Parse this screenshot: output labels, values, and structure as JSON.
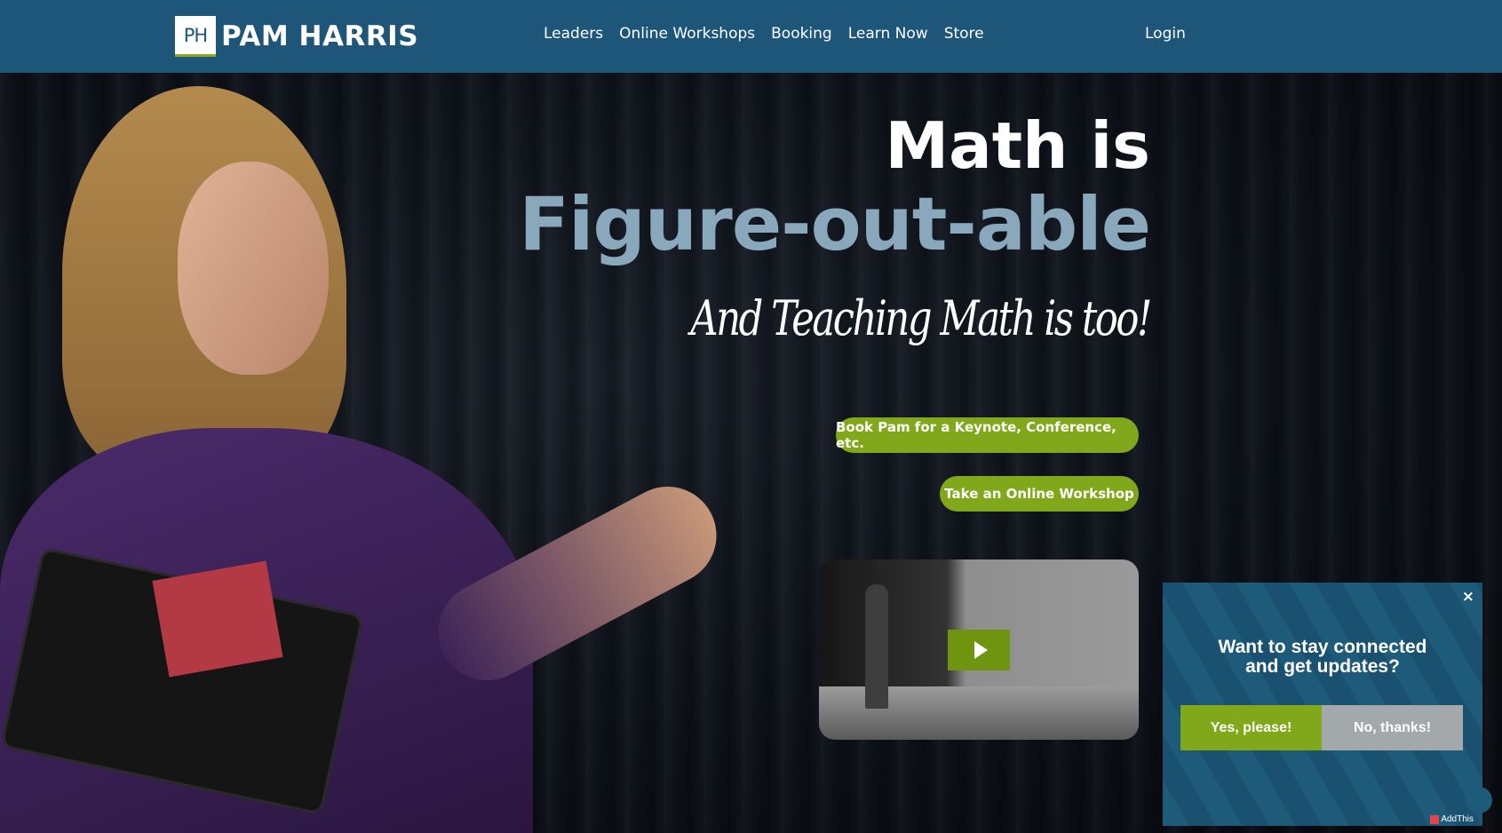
{
  "header": {
    "logo_mark": "PH",
    "logo_text": "PAM HARRIS",
    "nav": [
      "Leaders",
      "Online Workshops",
      "Booking",
      "Learn Now",
      "Store"
    ],
    "login": "Login"
  },
  "hero": {
    "headline_line1": "Math is",
    "headline_line2": "Figure-out-able",
    "tagline": "And Teaching Math is too!",
    "book_button": "Book Pam for a Keynote, Conference, etc.",
    "workshop_button": "Take an Online Workshop"
  },
  "popup": {
    "close": "×",
    "title_line1": "Want to stay connected",
    "title_line2": "and get updates?",
    "yes": "Yes, please!",
    "no": "No, thanks!",
    "addthis": "AddThis"
  },
  "colors": {
    "header": "#1d5678",
    "accent_green": "#80a81a",
    "headline_blue": "#8aa8bb",
    "popup_bg": "#1e5a79"
  }
}
